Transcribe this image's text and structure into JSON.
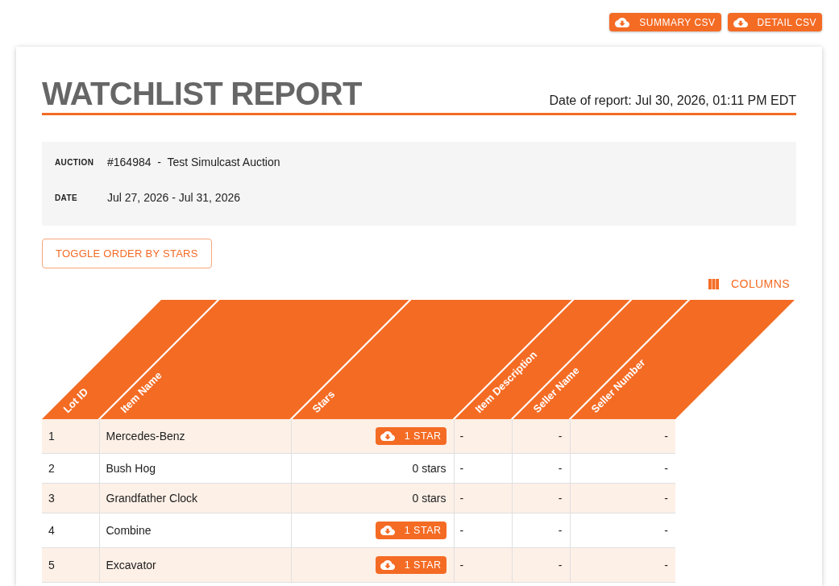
{
  "export_buttons": [
    {
      "label": "SUMMARY CSV"
    },
    {
      "label": "DETAIL CSV"
    }
  ],
  "report": {
    "title": "WATCHLIST REPORT",
    "date_of_report": "Date of report: Jul 30, 2026, 01:11 PM EDT"
  },
  "details": [
    {
      "label": "AUCTION",
      "value": "#164984  -  Test Simulcast Auction"
    },
    {
      "label": "DATE",
      "value": "Jul 27, 2026 - Jul 31, 2026"
    }
  ],
  "toggle_button": {
    "label": "TOGGLE ORDER BY STARS"
  },
  "columns_button": {
    "label": "COLUMNS"
  },
  "table": {
    "columns": [
      "Lot ID",
      "Item Name",
      "Stars",
      "Item Description",
      "Seller Name",
      "Seller Number"
    ],
    "rows": [
      {
        "lot_id": "1",
        "item_name": "Mercedes-Benz",
        "star_count": {
          "kind": "button",
          "label": "1 STAR"
        },
        "item_description": "-",
        "seller_name": "-",
        "seller_number": "-"
      },
      {
        "lot_id": "2",
        "item_name": "Bush Hog",
        "star_count": {
          "kind": "text",
          "label": "0 stars"
        },
        "item_description": "-",
        "seller_name": "-",
        "seller_number": "-"
      },
      {
        "lot_id": "3",
        "item_name": "Grandfather Clock",
        "star_count": {
          "kind": "text",
          "label": "0 stars"
        },
        "item_description": "-",
        "seller_name": "-",
        "seller_number": "-"
      },
      {
        "lot_id": "4",
        "item_name": "Combine",
        "star_count": {
          "kind": "button",
          "label": "1 STAR"
        },
        "item_description": "-",
        "seller_name": "-",
        "seller_number": "-"
      },
      {
        "lot_id": "5",
        "item_name": "Excavator",
        "star_count": {
          "kind": "button",
          "label": "1 STAR"
        },
        "item_description": "-",
        "seller_name": "-",
        "seller_number": "-"
      }
    ]
  }
}
